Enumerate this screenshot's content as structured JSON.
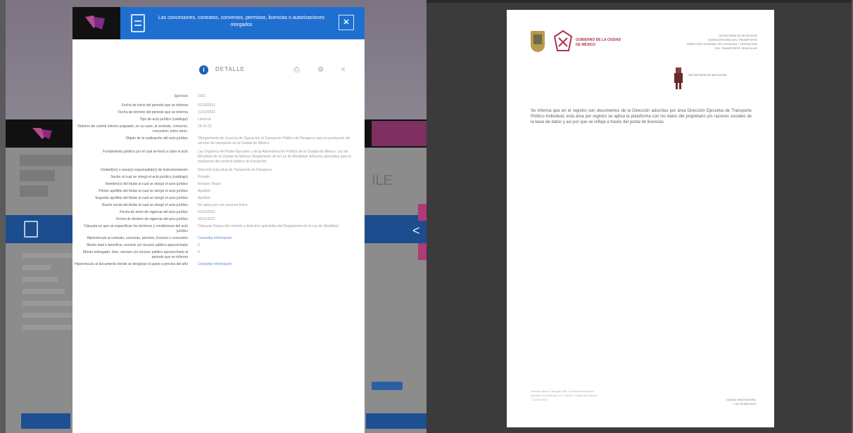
{
  "modal": {
    "title": "Las concesiones, contratos, convenios, permisos, licencias o autorizaciones otorgados",
    "close": "✕",
    "details_label": "DETALLE",
    "info": "i",
    "print_icon": "⎙",
    "settings_icon": "⚙",
    "share_icon": "<",
    "rows": [
      {
        "label": "Ejercicio",
        "value": "2021"
      },
      {
        "label": "Fecha de inicio del periodo que se informa",
        "value": "01/10/2021"
      },
      {
        "label": "Fecha de término del periodo que se informa",
        "value": "31/12/2021"
      },
      {
        "label": "Tipo de acto jurídico (catálogo)",
        "value": "Licencia"
      },
      {
        "label": "Número de control interno asignado, en su caso, al contrato, convenio, concesión, entre otros.",
        "value": "18-10-21"
      },
      {
        "label": "Objeto de la realización del acto jurídico",
        "value": "Otorgamiento de Licencia de Operación al Transporte Público de Pasajeros para la prestación del servicio de transporte en la Ciudad de México"
      },
      {
        "label": "Fundamento jurídico por el cual se llevó a cabo el acto",
        "value": "Ley Orgánica del Poder Ejecutivo y de la Administración Pública de la Ciudad de México; Ley de Movilidad de la Ciudad de México; Reglamento de la Ley de Movilidad; Artículos aplicables para la prestación del servicio público de transporte"
      },
      {
        "label": "Unidad(es) o área(s) responsable(s) de instrumentación",
        "value": "Dirección Ejecutiva de Transporte de Pasajeros"
      },
      {
        "label": "Sector al cual se otorgó el acto jurídico (catálogo)",
        "value": "Privado"
      },
      {
        "label": "Nombre(s) del titular al cual se otorgó el acto jurídico",
        "value": "Nombre Titular"
      },
      {
        "label": "Primer apellido del titular al cual se otorgó el acto jurídico",
        "value": "Apellido"
      },
      {
        "label": "Segundo apellido del titular al cual se otorgó el acto jurídico",
        "value": "Apellido"
      },
      {
        "label": "Razón social del titular al cual se otorgó el acto jurídico",
        "value": "No aplica por ser persona física"
      },
      {
        "label": "Fecha de inicio de vigencia del acto jurídico",
        "value": "01/10/2021"
      },
      {
        "label": "Fecha de término de vigencia del acto jurídico",
        "value": "30/11/2021"
      },
      {
        "label": "Cláusula en que se especifican los términos y condiciones del acto jurídico",
        "value": "Cláusula Octava del contrato y Artículos aplicables del Reglamento de la Ley de Movilidad"
      },
      {
        "label": "Hipervínculo al contrato, convenio, permiso, licencia o concesión",
        "value": "Consultar información",
        "link": true
      },
      {
        "label": "Monto total o beneficio, servicio y/o recurso público aprovechado",
        "value": "0"
      },
      {
        "label": "Monto entregado, bien, servicio y/o recurso público aprovechado al periodo que se informa",
        "value": "0"
      },
      {
        "label": "Hipervínculo al documento donde se desglose el gasto a precios del año",
        "value": "Consultar información",
        "link": true
      }
    ]
  },
  "pdf": {
    "cdmx_name": "GOBIERNO DE LA CIUDAD DE MÉXICO",
    "header_lines": [
      "SECRETARÍA DE MOVILIDAD",
      "SUBSECRETARÍA DEL TRANSPORTE",
      "DIRECCIÓN GENERAL DE LICENCIAS Y OPERACIÓN",
      "DEL TRANSPORTE VEHICULAR"
    ],
    "secretaria_name": "SECRETARÍA DE MOVILIDAD",
    "body": "Se informa que en el registro son documentos de la Dirección adscritas por área Dirección Ejecutiva de Transporte Público Individual, esta área por registro se aplica la plataforma con los datos del propietario y/o razones sociales de la base de datos y así por que se refleja a través del portal de licencias.",
    "footer_left": [
      "Avenida Álvaro Obregón 269, Colonia Roma Norte",
      "Alcaldía Cuauhtémoc, C.P. 06700, Ciudad de México",
      "T. 5209 9913"
    ],
    "footer_right": [
      "CIUDAD INNOVADORA",
      "Y DE DERECHOS"
    ]
  },
  "background": {
    "faint_text": "ILE",
    "share_glyph": "<"
  }
}
